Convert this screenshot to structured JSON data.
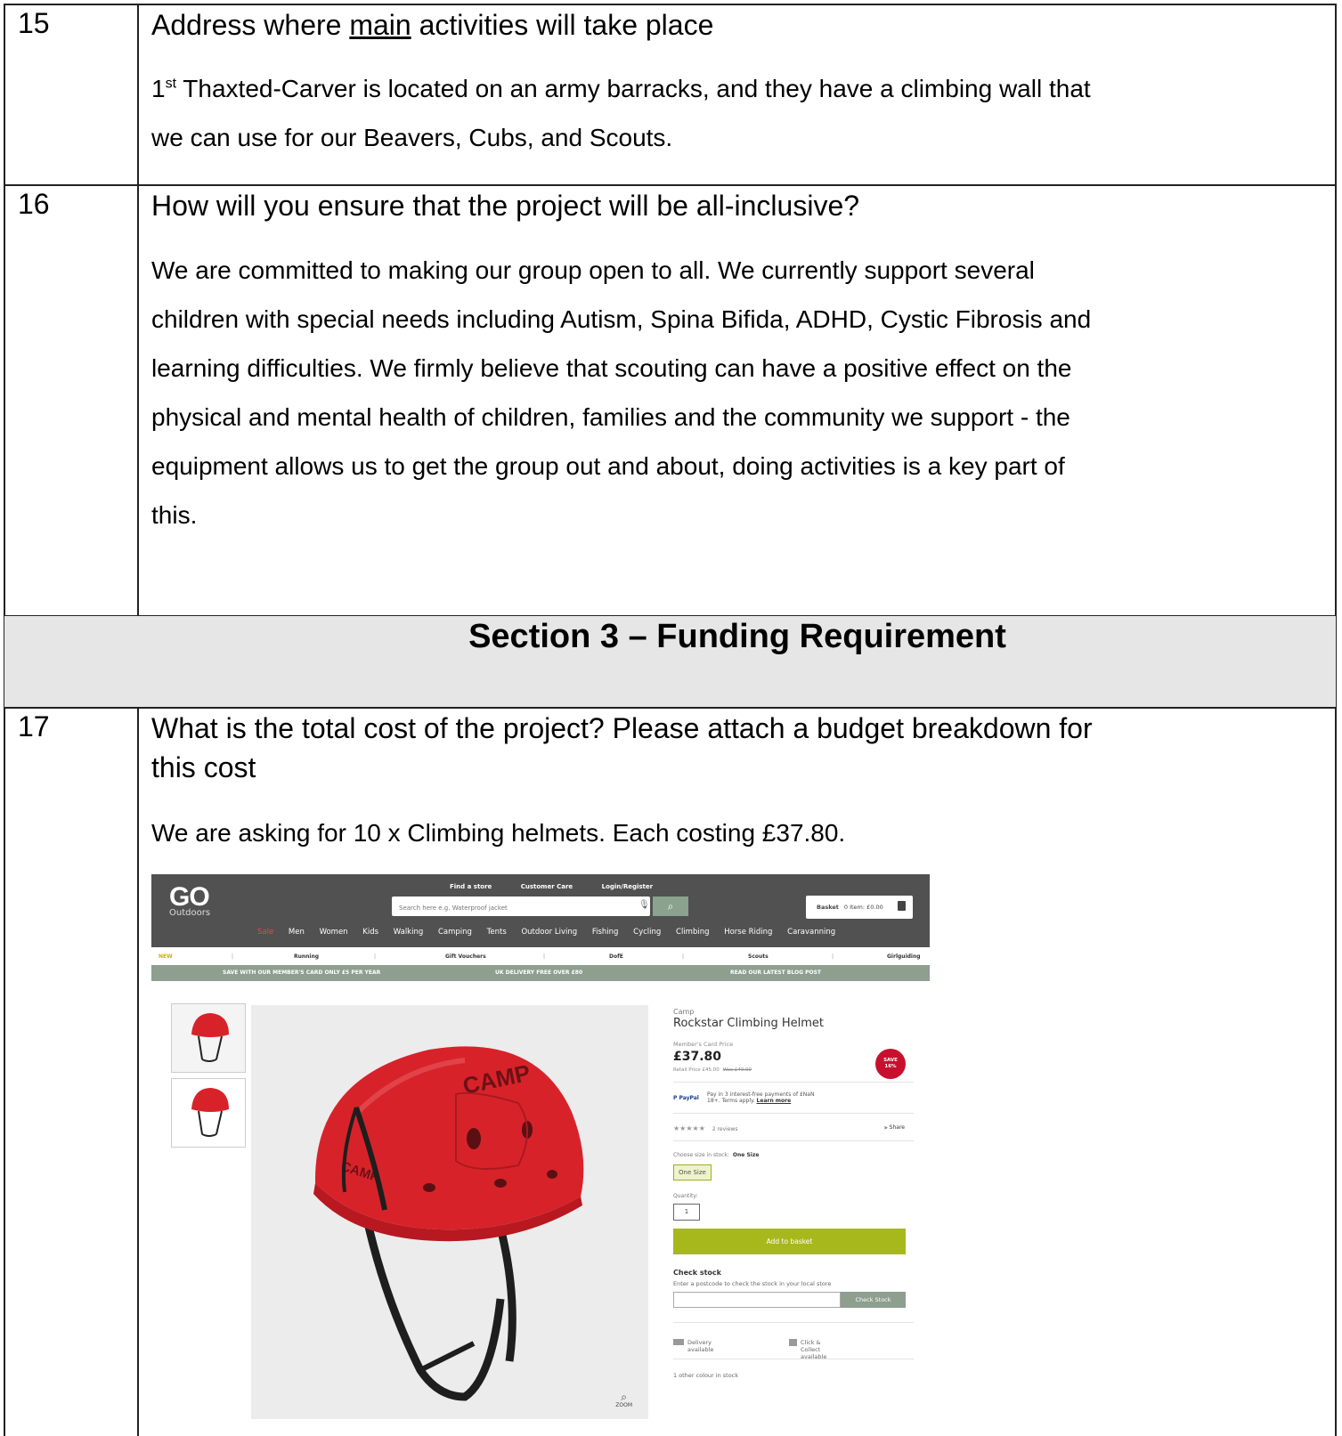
{
  "rows": [
    {
      "number": "15",
      "question_before": "Address where ",
      "question_underlined": "main",
      "question_after": " activities will take place",
      "answer_sup_base": "1",
      "answer_sup": "st",
      "answer_line1": " Thaxted-Carver is located on an army barracks, and they have a climbing wall that",
      "answer_line2": "we can use for our Beavers, Cubs, and Scouts."
    },
    {
      "number": "16",
      "question": "How will you ensure that the project will be all-inclusive?",
      "answer_lines": [
        "We are committed to making our group open to all. We currently support several",
        "children with special needs including Autism, Spina Bifida, ADHD, Cystic Fibrosis and",
        "learning difficulties. We firmly believe that scouting can have a positive effect on the",
        "physical and mental health of children, families and the community we support - the",
        "equipment allows us to get the group out and about, doing activities is a key part of",
        "this."
      ]
    },
    {
      "number": "17",
      "question_line1": "What is the total cost of the project? Please attach a budget breakdown for",
      "question_line2": "this cost",
      "answer": "We are asking for 10 x Climbing helmets. Each costing £37.80."
    }
  ],
  "section_title": "Section 3 – Funding Requirement",
  "webpage": {
    "logo": "GO",
    "logo_sub": "Outdoors",
    "top_links": [
      "Find a store",
      "Customer Care",
      "Login/Register"
    ],
    "search_placeholder": "Search here e.g. Waterproof jacket",
    "basket_label": "Basket",
    "basket_summary": "0 Item: £0.00",
    "nav": [
      "Sale",
      "Men",
      "Women",
      "Kids",
      "Walking",
      "Camping",
      "Tents",
      "Outdoor Living",
      "Fishing",
      "Cycling",
      "Climbing",
      "Horse Riding",
      "Caravanning"
    ],
    "subnav": [
      "NEW",
      "Running",
      "Gift Vouchers",
      "DofE",
      "Scouts",
      "Girlguiding"
    ],
    "promos": [
      "SAVE WITH OUR MEMBER'S CARD ONLY £5 PER YEAR",
      "UK DELIVERY FREE OVER £80",
      "READ OUR LATEST BLOG POST"
    ],
    "product": {
      "brand": "Camp",
      "title": "Rockstar Climbing Helmet",
      "members_label": "Member's Card Price",
      "price": "£37.80",
      "retail": "Retail Price £45.00",
      "was": "Was £40.00",
      "save_line1": "SAVE",
      "save_line2": "16%",
      "paypal_logo": "P PayPal",
      "paypal_line1": "Pay in 3 interest-free payments of £NaN",
      "paypal_line2": "18+. Terms apply.",
      "learn_more": "Learn more",
      "stars": "★★★★★",
      "reviews": "2 reviews",
      "share": "Share",
      "size_label": "Choose size in stock:",
      "size_selected": "One Size",
      "size_option": "One Size",
      "qty_label": "Quantity:",
      "qty": "1",
      "add_to_basket": "Add to basket",
      "check_stock_title": "Check stock",
      "check_stock_desc": "Enter a postcode to check the stock in your local store",
      "check_stock_btn": "Check Stock",
      "delivery": "Delivery available",
      "collect": "Click & Collect available",
      "other_colour": "1 other colour in stock",
      "zoom": "ZOOM",
      "helmet_color": "#d8222a"
    }
  }
}
